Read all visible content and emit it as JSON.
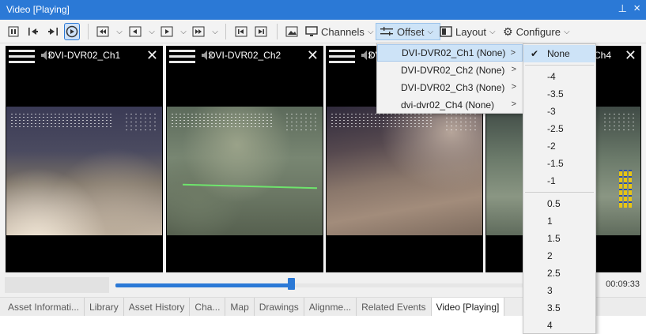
{
  "window": {
    "title": "Video [Playing]",
    "pin_icon": "pin-icon",
    "close_icon": "close-icon"
  },
  "toolbar": {
    "channels_label": "Channels",
    "offset_label": "Offset",
    "layout_label": "Layout",
    "configure_label": "Configure"
  },
  "panels": [
    {
      "name": "DVI-DVR02_Ch1"
    },
    {
      "name": "DVI-DVR02_Ch2"
    },
    {
      "name": "DVI-DVR02_Ch3"
    },
    {
      "name": "Ch4"
    }
  ],
  "timeline": {
    "time": "00:09:33",
    "progress": 0.426
  },
  "tabs": [
    "Asset Informati...",
    "Library",
    "Asset History",
    "Cha...",
    "Map",
    "Drawings",
    "Alignme...",
    "Related Events",
    "Video [Playing]"
  ],
  "active_tab": "Video [Playing]",
  "offset_menu": {
    "items": [
      "DVI-DVR02_Ch1 (None)",
      "DVI-DVR02_Ch2 (None)",
      "DVI-DVR02_Ch3 (None)",
      "dvi-dvr02_Ch4 (None)"
    ],
    "highlighted": 0
  },
  "offset_submenu": {
    "selected": "None",
    "group_none": [
      "None"
    ],
    "group_negative": [
      "-4",
      "-3.5",
      "-3",
      "-2.5",
      "-2",
      "-1.5",
      "-1"
    ],
    "group_positive": [
      "0.5",
      "1",
      "1.5",
      "2",
      "2.5",
      "3",
      "3.5",
      "4"
    ]
  },
  "colors": {
    "accent": "#2b79d6",
    "menu_highlight": "#cde3f7",
    "toolbar_bg": "#f3f3f3"
  }
}
